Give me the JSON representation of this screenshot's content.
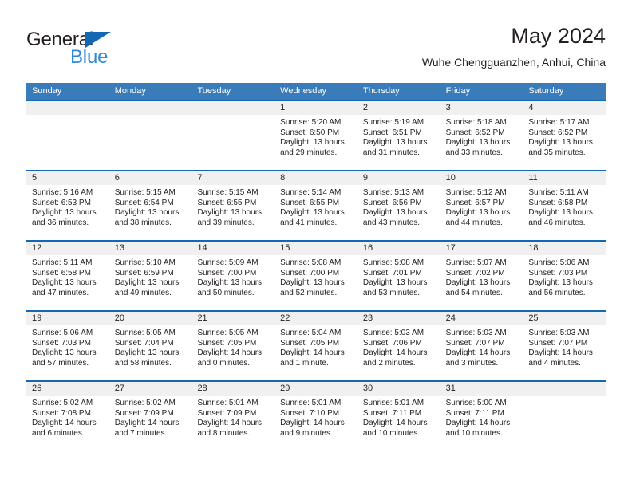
{
  "brand": {
    "name_top": "General",
    "name_bottom": "Blue",
    "triangle_color": "#1268b3",
    "blue_color": "#2e8ad4"
  },
  "header": {
    "title": "May 2024",
    "subtitle": "Wuhe Chengguanzhen, Anhui, China"
  },
  "theme": {
    "header_bg": "#3a7cba",
    "rule_color": "#1268b3",
    "day_number_bg": "#f0f0f0",
    "text_color": "#231f20"
  },
  "weekdays": [
    "Sunday",
    "Monday",
    "Tuesday",
    "Wednesday",
    "Thursday",
    "Friday",
    "Saturday"
  ],
  "weeks": [
    [
      {
        "day": "",
        "sunrise": "",
        "sunset": "",
        "daylight": "",
        "empty": true
      },
      {
        "day": "",
        "sunrise": "",
        "sunset": "",
        "daylight": "",
        "empty": true
      },
      {
        "day": "",
        "sunrise": "",
        "sunset": "",
        "daylight": "",
        "empty": true
      },
      {
        "day": "1",
        "sunrise": "Sunrise: 5:20 AM",
        "sunset": "Sunset: 6:50 PM",
        "daylight": "Daylight: 13 hours and 29 minutes."
      },
      {
        "day": "2",
        "sunrise": "Sunrise: 5:19 AM",
        "sunset": "Sunset: 6:51 PM",
        "daylight": "Daylight: 13 hours and 31 minutes."
      },
      {
        "day": "3",
        "sunrise": "Sunrise: 5:18 AM",
        "sunset": "Sunset: 6:52 PM",
        "daylight": "Daylight: 13 hours and 33 minutes."
      },
      {
        "day": "4",
        "sunrise": "Sunrise: 5:17 AM",
        "sunset": "Sunset: 6:52 PM",
        "daylight": "Daylight: 13 hours and 35 minutes."
      }
    ],
    [
      {
        "day": "5",
        "sunrise": "Sunrise: 5:16 AM",
        "sunset": "Sunset: 6:53 PM",
        "daylight": "Daylight: 13 hours and 36 minutes."
      },
      {
        "day": "6",
        "sunrise": "Sunrise: 5:15 AM",
        "sunset": "Sunset: 6:54 PM",
        "daylight": "Daylight: 13 hours and 38 minutes."
      },
      {
        "day": "7",
        "sunrise": "Sunrise: 5:15 AM",
        "sunset": "Sunset: 6:55 PM",
        "daylight": "Daylight: 13 hours and 39 minutes."
      },
      {
        "day": "8",
        "sunrise": "Sunrise: 5:14 AM",
        "sunset": "Sunset: 6:55 PM",
        "daylight": "Daylight: 13 hours and 41 minutes."
      },
      {
        "day": "9",
        "sunrise": "Sunrise: 5:13 AM",
        "sunset": "Sunset: 6:56 PM",
        "daylight": "Daylight: 13 hours and 43 minutes."
      },
      {
        "day": "10",
        "sunrise": "Sunrise: 5:12 AM",
        "sunset": "Sunset: 6:57 PM",
        "daylight": "Daylight: 13 hours and 44 minutes."
      },
      {
        "day": "11",
        "sunrise": "Sunrise: 5:11 AM",
        "sunset": "Sunset: 6:58 PM",
        "daylight": "Daylight: 13 hours and 46 minutes."
      }
    ],
    [
      {
        "day": "12",
        "sunrise": "Sunrise: 5:11 AM",
        "sunset": "Sunset: 6:58 PM",
        "daylight": "Daylight: 13 hours and 47 minutes."
      },
      {
        "day": "13",
        "sunrise": "Sunrise: 5:10 AM",
        "sunset": "Sunset: 6:59 PM",
        "daylight": "Daylight: 13 hours and 49 minutes."
      },
      {
        "day": "14",
        "sunrise": "Sunrise: 5:09 AM",
        "sunset": "Sunset: 7:00 PM",
        "daylight": "Daylight: 13 hours and 50 minutes."
      },
      {
        "day": "15",
        "sunrise": "Sunrise: 5:08 AM",
        "sunset": "Sunset: 7:00 PM",
        "daylight": "Daylight: 13 hours and 52 minutes."
      },
      {
        "day": "16",
        "sunrise": "Sunrise: 5:08 AM",
        "sunset": "Sunset: 7:01 PM",
        "daylight": "Daylight: 13 hours and 53 minutes."
      },
      {
        "day": "17",
        "sunrise": "Sunrise: 5:07 AM",
        "sunset": "Sunset: 7:02 PM",
        "daylight": "Daylight: 13 hours and 54 minutes."
      },
      {
        "day": "18",
        "sunrise": "Sunrise: 5:06 AM",
        "sunset": "Sunset: 7:03 PM",
        "daylight": "Daylight: 13 hours and 56 minutes."
      }
    ],
    [
      {
        "day": "19",
        "sunrise": "Sunrise: 5:06 AM",
        "sunset": "Sunset: 7:03 PM",
        "daylight": "Daylight: 13 hours and 57 minutes."
      },
      {
        "day": "20",
        "sunrise": "Sunrise: 5:05 AM",
        "sunset": "Sunset: 7:04 PM",
        "daylight": "Daylight: 13 hours and 58 minutes."
      },
      {
        "day": "21",
        "sunrise": "Sunrise: 5:05 AM",
        "sunset": "Sunset: 7:05 PM",
        "daylight": "Daylight: 14 hours and 0 minutes."
      },
      {
        "day": "22",
        "sunrise": "Sunrise: 5:04 AM",
        "sunset": "Sunset: 7:05 PM",
        "daylight": "Daylight: 14 hours and 1 minute."
      },
      {
        "day": "23",
        "sunrise": "Sunrise: 5:03 AM",
        "sunset": "Sunset: 7:06 PM",
        "daylight": "Daylight: 14 hours and 2 minutes."
      },
      {
        "day": "24",
        "sunrise": "Sunrise: 5:03 AM",
        "sunset": "Sunset: 7:07 PM",
        "daylight": "Daylight: 14 hours and 3 minutes."
      },
      {
        "day": "25",
        "sunrise": "Sunrise: 5:03 AM",
        "sunset": "Sunset: 7:07 PM",
        "daylight": "Daylight: 14 hours and 4 minutes."
      }
    ],
    [
      {
        "day": "26",
        "sunrise": "Sunrise: 5:02 AM",
        "sunset": "Sunset: 7:08 PM",
        "daylight": "Daylight: 14 hours and 6 minutes."
      },
      {
        "day": "27",
        "sunrise": "Sunrise: 5:02 AM",
        "sunset": "Sunset: 7:09 PM",
        "daylight": "Daylight: 14 hours and 7 minutes."
      },
      {
        "day": "28",
        "sunrise": "Sunrise: 5:01 AM",
        "sunset": "Sunset: 7:09 PM",
        "daylight": "Daylight: 14 hours and 8 minutes."
      },
      {
        "day": "29",
        "sunrise": "Sunrise: 5:01 AM",
        "sunset": "Sunset: 7:10 PM",
        "daylight": "Daylight: 14 hours and 9 minutes."
      },
      {
        "day": "30",
        "sunrise": "Sunrise: 5:01 AM",
        "sunset": "Sunset: 7:11 PM",
        "daylight": "Daylight: 14 hours and 10 minutes."
      },
      {
        "day": "31",
        "sunrise": "Sunrise: 5:00 AM",
        "sunset": "Sunset: 7:11 PM",
        "daylight": "Daylight: 14 hours and 10 minutes."
      },
      {
        "day": "",
        "sunrise": "",
        "sunset": "",
        "daylight": "",
        "empty": true
      }
    ]
  ]
}
